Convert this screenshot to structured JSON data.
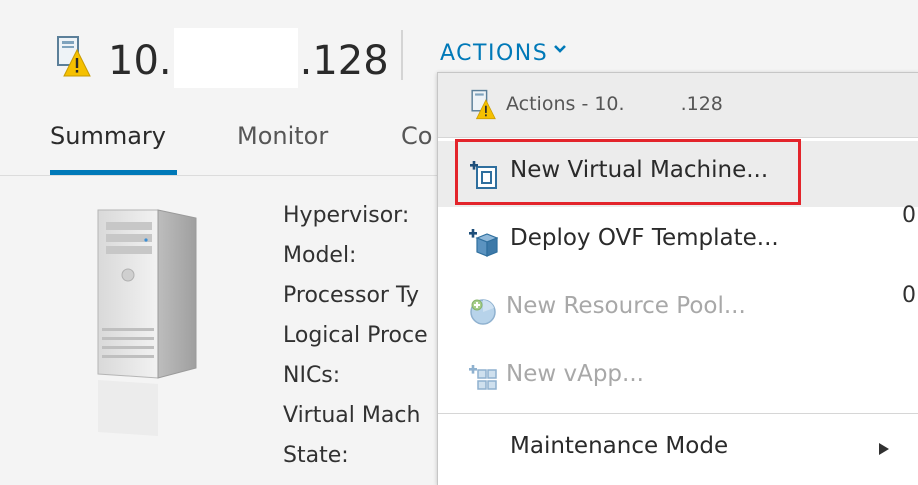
{
  "header": {
    "title_prefix": "10.",
    "title_suffix": ".128",
    "actions_label": "ACTIONS"
  },
  "tabs": [
    {
      "label": "Summary",
      "active": true
    },
    {
      "label": "Monitor",
      "active": false
    },
    {
      "label": "Co",
      "active": false
    }
  ],
  "summary": {
    "properties": [
      "Hypervisor:",
      "Model:",
      "Processor Ty",
      "Logical Proce",
      "NICs:",
      "Virtual Mach",
      "State:"
    ],
    "edge_fragments": [
      "0",
      "0"
    ]
  },
  "menu": {
    "header_prefix": "Actions - 10.",
    "header_suffix": ".128",
    "items": [
      {
        "label": "New Virtual Machine...",
        "icon": "new-vm-icon",
        "enabled": true,
        "highlighted": true
      },
      {
        "label": "Deploy OVF Template...",
        "icon": "deploy-ovf-icon",
        "enabled": true,
        "highlighted": false
      },
      {
        "label": "New Resource Pool...",
        "icon": "resource-pool-icon",
        "enabled": false,
        "highlighted": false
      },
      {
        "label": "New vApp...",
        "icon": "vapp-icon",
        "enabled": false,
        "highlighted": false
      },
      {
        "label": "Maintenance Mode",
        "icon": "",
        "enabled": true,
        "highlighted": false,
        "submenu": true
      }
    ]
  },
  "colors": {
    "accent": "#0079b8",
    "highlight_box": "#e3242b",
    "warning": "#f5c000"
  }
}
